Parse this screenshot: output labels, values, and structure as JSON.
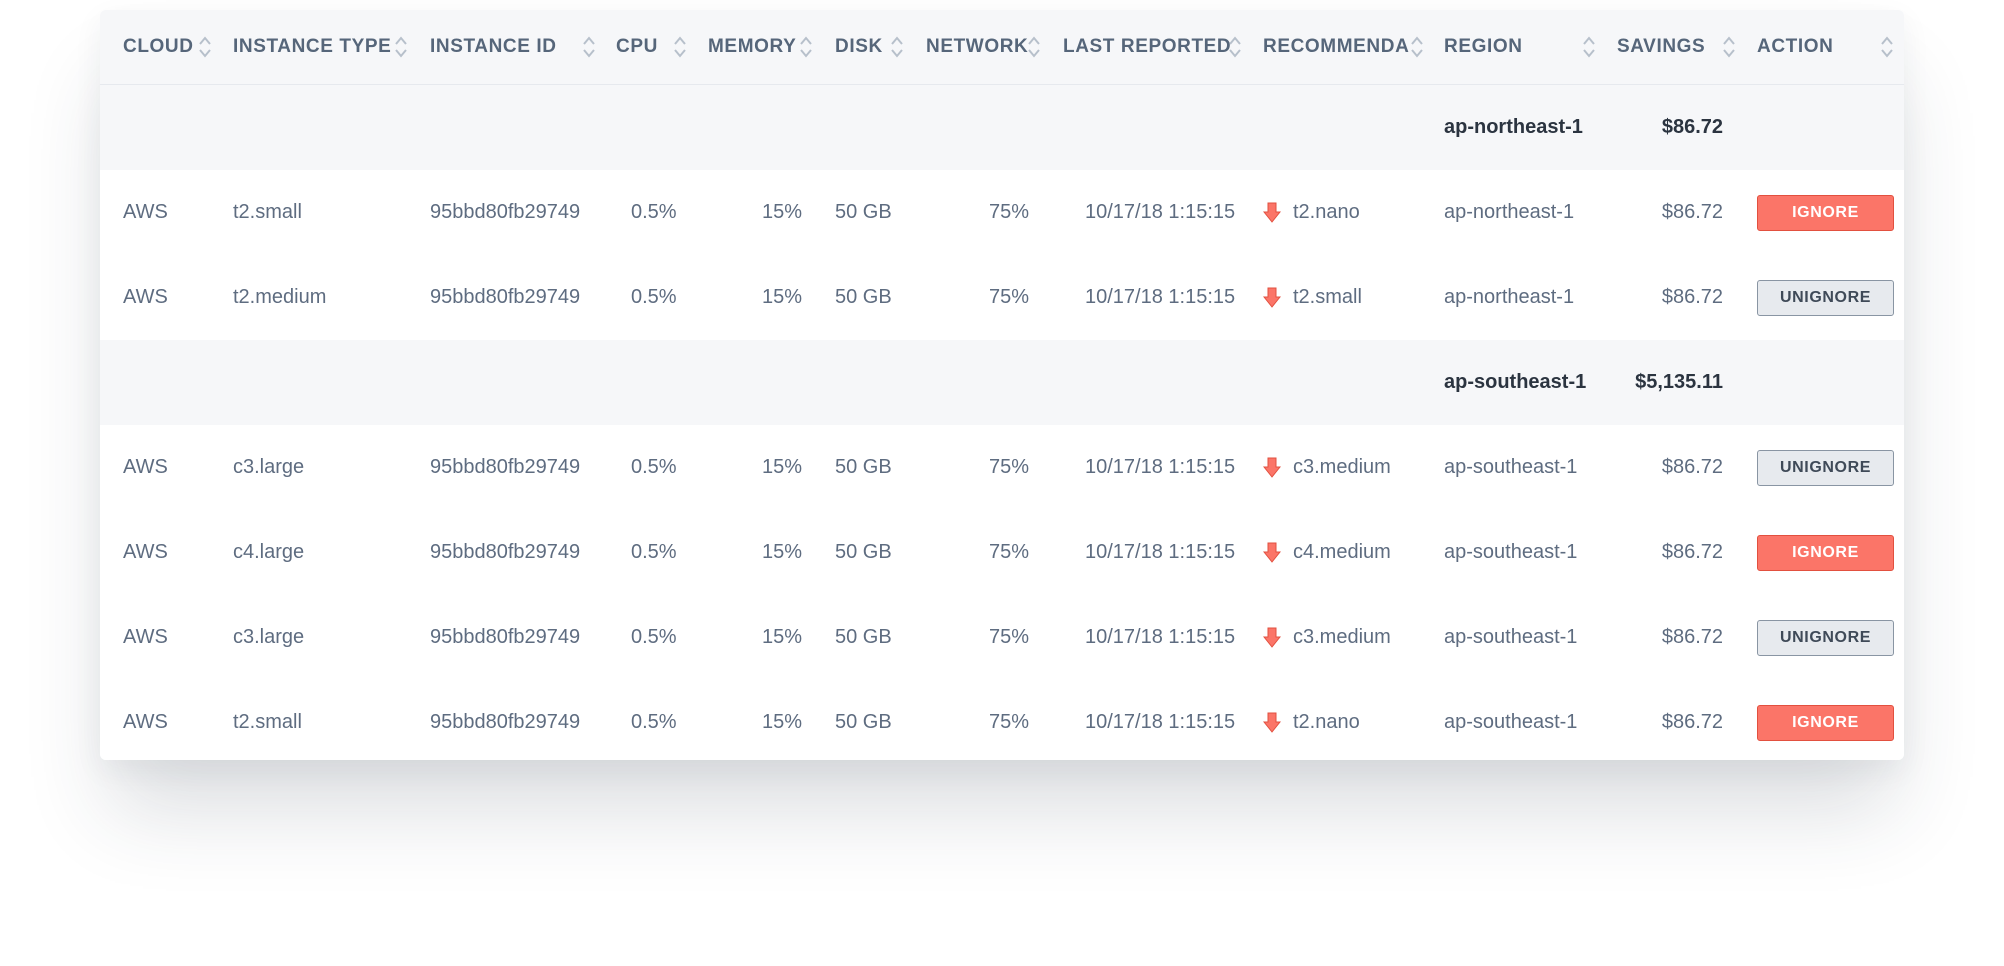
{
  "colors": {
    "accent_red": "#fb7568",
    "header_bg": "#f6f7f9",
    "text": "#5e6c80",
    "border": "#e6e9ee"
  },
  "columns": {
    "cloud": "CLOUD",
    "instance_type": "INSTANCE TYPE",
    "instance_id": "INSTANCE ID",
    "cpu": "CPU",
    "memory": "MEMORY",
    "disk": "DISK",
    "network": "NETWORK",
    "last_reported": "LAST REPORTED",
    "recommendation": "RECOMMENDA",
    "region": "REGION",
    "savings": "SAVINGS",
    "action": "ACTION"
  },
  "icons": {
    "sort": "sort-arrows-icon",
    "recommendation": "arrow-down-icon"
  },
  "groups": [
    {
      "region": "ap-northeast-1",
      "savings": "$86.72"
    },
    {
      "region": "ap-southeast-1",
      "savings": "$5,135.11"
    }
  ],
  "rows": [
    {
      "cloud": "AWS",
      "instance_type": "t2.small",
      "instance_id": "95bbd80fb29749",
      "cpu": "0.5%",
      "memory": "15%",
      "disk": "50 GB",
      "network": "75%",
      "last_reported": "10/17/18 1:15:15",
      "recommendation": "t2.nano",
      "region": "ap-northeast-1",
      "savings": "$86.72",
      "action": "IGNORE"
    },
    {
      "cloud": "AWS",
      "instance_type": "t2.medium",
      "instance_id": "95bbd80fb29749",
      "cpu": "0.5%",
      "memory": "15%",
      "disk": "50 GB",
      "network": "75%",
      "last_reported": "10/17/18 1:15:15",
      "recommendation": "t2.small",
      "region": "ap-northeast-1",
      "savings": "$86.72",
      "action": "UNIGNORE"
    },
    {
      "cloud": "AWS",
      "instance_type": "c3.large",
      "instance_id": "95bbd80fb29749",
      "cpu": "0.5%",
      "memory": "15%",
      "disk": "50 GB",
      "network": "75%",
      "last_reported": "10/17/18 1:15:15",
      "recommendation": "c3.medium",
      "region": "ap-southeast-1",
      "savings": "$86.72",
      "action": "UNIGNORE"
    },
    {
      "cloud": "AWS",
      "instance_type": "c4.large",
      "instance_id": "95bbd80fb29749",
      "cpu": "0.5%",
      "memory": "15%",
      "disk": "50 GB",
      "network": "75%",
      "last_reported": "10/17/18 1:15:15",
      "recommendation": "c4.medium",
      "region": "ap-southeast-1",
      "savings": "$86.72",
      "action": "IGNORE"
    },
    {
      "cloud": "AWS",
      "instance_type": "c3.large",
      "instance_id": "95bbd80fb29749",
      "cpu": "0.5%",
      "memory": "15%",
      "disk": "50 GB",
      "network": "75%",
      "last_reported": "10/17/18 1:15:15",
      "recommendation": "c3.medium",
      "region": "ap-southeast-1",
      "savings": "$86.72",
      "action": "UNIGNORE"
    },
    {
      "cloud": "AWS",
      "instance_type": "t2.small",
      "instance_id": "95bbd80fb29749",
      "cpu": "0.5%",
      "memory": "15%",
      "disk": "50 GB",
      "network": "75%",
      "last_reported": "10/17/18 1:15:15",
      "recommendation": "t2.nano",
      "region": "ap-southeast-1",
      "savings": "$86.72",
      "action": "IGNORE"
    }
  ]
}
